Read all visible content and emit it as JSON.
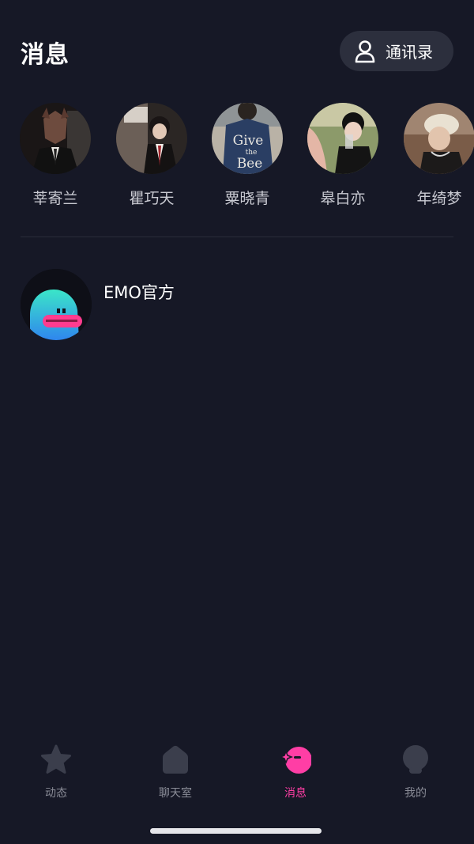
{
  "header": {
    "title": "消息",
    "contacts_label": "通讯录"
  },
  "friends": [
    {
      "name": "莘寄兰"
    },
    {
      "name": "瞿巧天"
    },
    {
      "name": "粟晓青",
      "avatar_text_lines": [
        "Give",
        "the",
        "Bee"
      ]
    },
    {
      "name": "皋白亦"
    },
    {
      "name": "年绮梦"
    }
  ],
  "conversations": [
    {
      "name": "EMO官方"
    }
  ],
  "tabs": [
    {
      "label": "动态",
      "icon": "star-icon"
    },
    {
      "label": "聊天室",
      "icon": "home-icon"
    },
    {
      "label": "消息",
      "icon": "message-icon",
      "active": true
    },
    {
      "label": "我的",
      "icon": "profile-icon"
    }
  ],
  "colors": {
    "background": "#161826",
    "accent": "#ff3ea5",
    "inactive": "#8a8c97"
  }
}
